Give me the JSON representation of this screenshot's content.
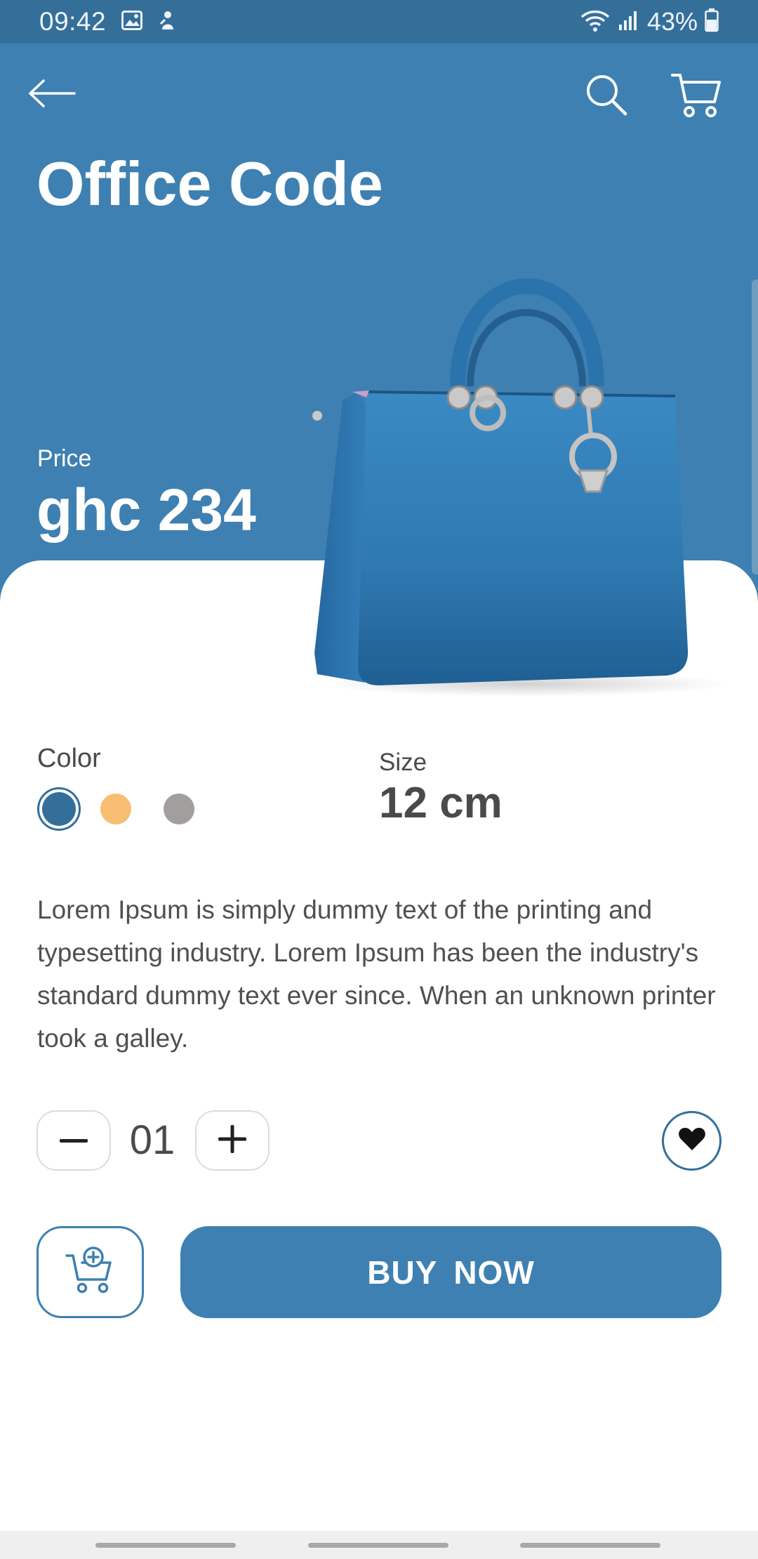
{
  "status_bar": {
    "time": "09:42",
    "battery": "43%",
    "icons": [
      "gallery-icon",
      "person-notification-icon",
      "wifi-icon",
      "signal-icon",
      "battery-icon"
    ]
  },
  "header": {
    "back_icon": "arrow-left-icon",
    "search_icon": "search-icon",
    "cart_icon": "cart-icon"
  },
  "product": {
    "title": "Office Code",
    "price_label": "Price",
    "price": "ghc 234",
    "image": "blue-handbag"
  },
  "options": {
    "color_label": "Color",
    "colors": [
      {
        "name": "blue",
        "hex": "#346f9a",
        "selected": true
      },
      {
        "name": "orange",
        "hex": "#f7be73",
        "selected": false
      },
      {
        "name": "grey",
        "hex": "#a39e9e",
        "selected": false
      }
    ],
    "size_label": "Size",
    "size_value": "12 cm"
  },
  "description": "Lorem Ipsum is simply dummy text of the printing and typesetting industry. Lorem Ipsum has been the industry's standard dummy text ever since. When an unknown printer took a galley.",
  "quantity": {
    "value": "01",
    "minus_icon": "minus-icon",
    "plus_icon": "plus-icon",
    "favorite_icon": "heart-icon"
  },
  "actions": {
    "add_to_cart_icon": "cart-add-icon",
    "buy_label": "BUY  NOW"
  },
  "colors": {
    "primary": "#3e80b1",
    "status_bar": "#346f9a",
    "text": "#4a4a4a",
    "white": "#ffffff"
  }
}
